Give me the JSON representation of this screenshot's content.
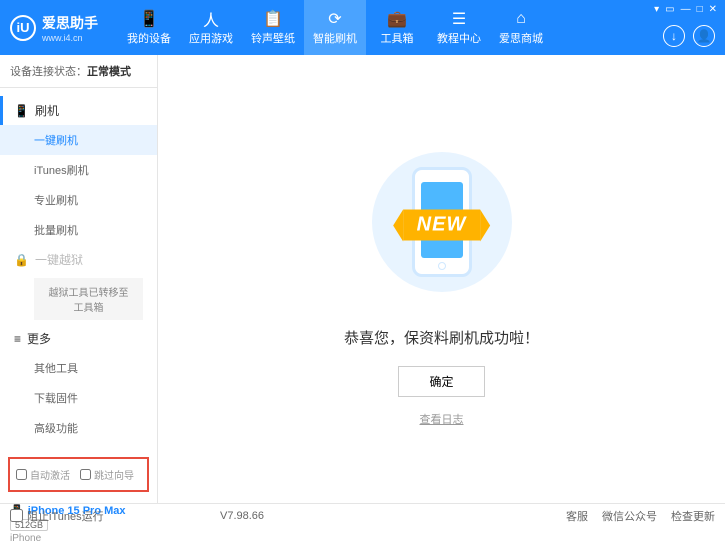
{
  "header": {
    "logo_letter": "iU",
    "logo_title": "爱思助手",
    "logo_sub": "www.i4.cn",
    "nav": [
      {
        "label": "我的设备",
        "icon": "📱"
      },
      {
        "label": "应用游戏",
        "icon": "人"
      },
      {
        "label": "铃声壁纸",
        "icon": "📋"
      },
      {
        "label": "智能刷机",
        "icon": "⟳"
      },
      {
        "label": "工具箱",
        "icon": "💼"
      },
      {
        "label": "教程中心",
        "icon": "☰"
      },
      {
        "label": "爱思商城",
        "icon": "⌂"
      }
    ]
  },
  "sidebar": {
    "status_label": "设备连接状态：",
    "status_value": "正常模式",
    "flash_header": "刷机",
    "flash_items": [
      "一键刷机",
      "iTunes刷机",
      "专业刷机",
      "批量刷机"
    ],
    "jailbreak_header": "一键越狱",
    "jailbreak_note": "越狱工具已转移至工具箱",
    "more_header": "更多",
    "more_items": [
      "其他工具",
      "下载固件",
      "高级功能"
    ],
    "checkbox1": "自动激活",
    "checkbox2": "跳过向导",
    "device_name": "iPhone 15 Pro Max",
    "device_storage": "512GB",
    "device_type": "iPhone"
  },
  "main": {
    "new_label": "NEW",
    "success_text": "恭喜您，保资料刷机成功啦！",
    "confirm_btn": "确定",
    "log_link": "查看日志"
  },
  "footer": {
    "block_itunes": "阻止iTunes运行",
    "version": "V7.98.66",
    "links": [
      "客服",
      "微信公众号",
      "检查更新"
    ]
  }
}
